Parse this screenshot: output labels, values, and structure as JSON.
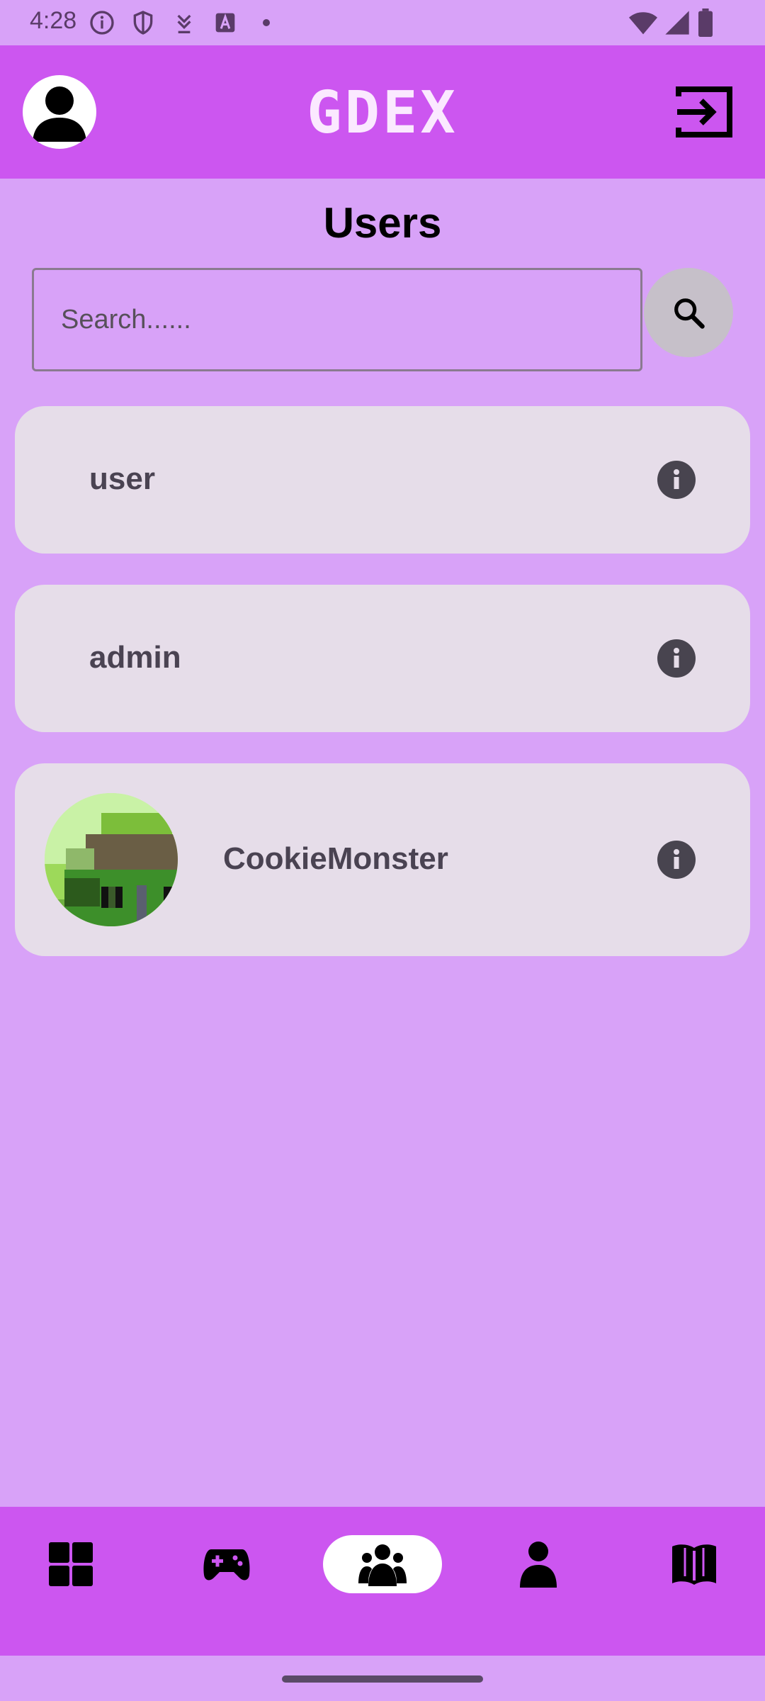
{
  "status_bar": {
    "time": "4:28",
    "left_icons": [
      "info-circle-icon",
      "shield-icon",
      "download-icon",
      "font-app-icon",
      "dot-icon"
    ],
    "right_icons": [
      "wifi-icon",
      "cellular-signal-icon",
      "battery-icon"
    ]
  },
  "header": {
    "logo_text": "GDEX",
    "profile_icon": "account-circle-icon",
    "logout_icon": "logout-icon"
  },
  "page": {
    "title": "Users"
  },
  "search": {
    "placeholder": "Search......",
    "value": "",
    "button_icon": "search-icon"
  },
  "users": [
    {
      "name": "user",
      "has_avatar": false,
      "action_icon": "info-icon"
    },
    {
      "name": "admin",
      "has_avatar": false,
      "action_icon": "info-icon"
    },
    {
      "name": "CookieMonster",
      "has_avatar": true,
      "action_icon": "info-icon"
    }
  ],
  "bottom_nav": {
    "items": [
      {
        "icon": "dashboard-icon",
        "active": false
      },
      {
        "icon": "gamepad-icon",
        "active": false
      },
      {
        "icon": "users-group-icon",
        "active": true
      },
      {
        "icon": "person-icon",
        "active": false
      },
      {
        "icon": "book-icon",
        "active": false
      }
    ]
  },
  "colors": {
    "background": "#d8a2f8",
    "app_bar": "#cc56f0",
    "card": "#e6dde9",
    "logo": "#fbe9ff",
    "active_nav": "#ffffff"
  }
}
